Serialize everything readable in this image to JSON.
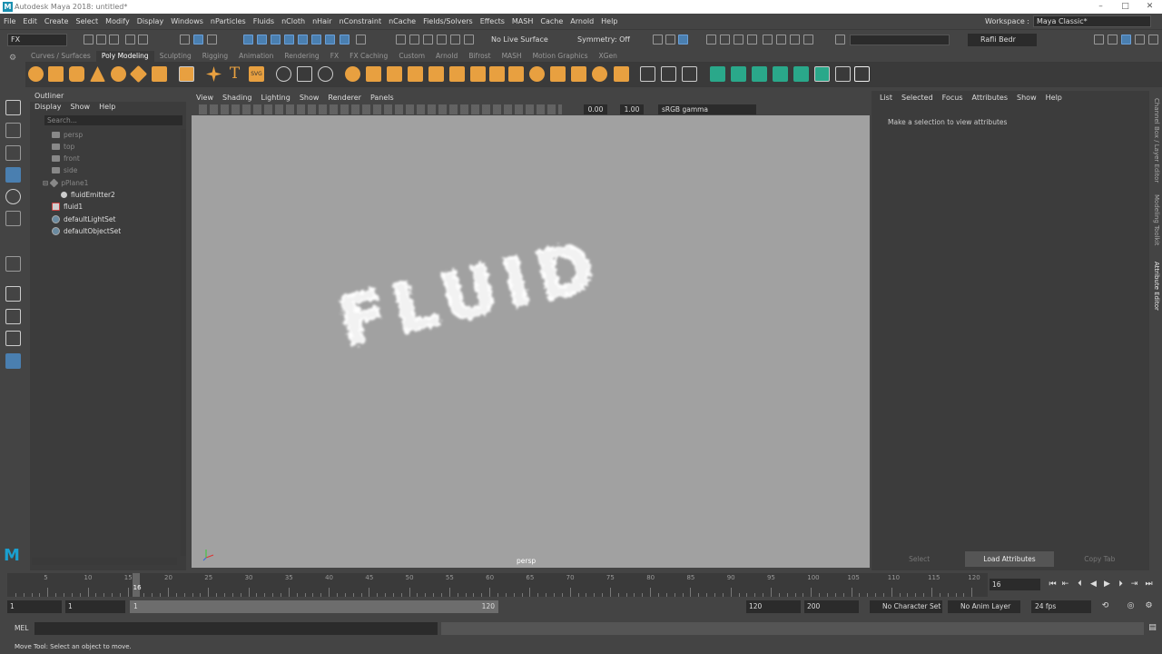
{
  "titlebar": {
    "title": "Autodesk Maya 2018: untitled*",
    "logo_letter": "M"
  },
  "menubar": {
    "items": [
      "File",
      "Edit",
      "Create",
      "Select",
      "Modify",
      "Display",
      "Windows",
      "nParticles",
      "Fluids",
      "nCloth",
      "nHair",
      "nConstraint",
      "nCache",
      "Fields/Solvers",
      "Effects",
      "MASH",
      "Cache",
      "Arnold",
      "Help"
    ],
    "workspace_label": "Workspace :",
    "workspace_value": "Maya Classic*"
  },
  "statusline": {
    "mode": "FX",
    "live_surface": "No Live Surface",
    "symmetry": "Symmetry: Off",
    "user": "Rafli Bedr"
  },
  "shelf": {
    "tabs": [
      "Curves / Surfaces",
      "Poly Modeling",
      "Sculpting",
      "Rigging",
      "Animation",
      "Rendering",
      "FX",
      "FX Caching",
      "Custom",
      "Arnold",
      "Bifrost",
      "MASH",
      "Motion Graphics",
      "XGen"
    ],
    "active_tab": "Poly Modeling",
    "text_icons": [
      "T",
      "SVG"
    ]
  },
  "outliner": {
    "title": "Outliner",
    "menu": [
      "Display",
      "Show",
      "Help"
    ],
    "search_placeholder": "Search...",
    "items": [
      {
        "label": "persp",
        "dim": true
      },
      {
        "label": "top",
        "dim": true
      },
      {
        "label": "front",
        "dim": true
      },
      {
        "label": "side",
        "dim": true
      },
      {
        "label": "pPlane1",
        "dim": true
      },
      {
        "label": "fluidEmitter2",
        "dim": false
      },
      {
        "label": "fluid1",
        "dim": false
      },
      {
        "label": "defaultLightSet",
        "dim": false
      },
      {
        "label": "defaultObjectSet",
        "dim": false
      }
    ]
  },
  "viewport": {
    "menu": [
      "View",
      "Shading",
      "Lighting",
      "Show",
      "Renderer",
      "Panels"
    ],
    "exposure": "0.00",
    "gamma": "1.00",
    "color_space": "sRGB gamma",
    "camera": "persp",
    "scene_text": "FLUID",
    "bg_color": "#a1a1a1"
  },
  "attribute_editor": {
    "menu": [
      "List",
      "Selected",
      "Focus",
      "Attributes",
      "Show",
      "Help"
    ],
    "message": "Make a selection to view attributes",
    "buttons": [
      "Select",
      "Load Attributes",
      "Copy Tab"
    ]
  },
  "side_tabs": [
    "Channel Box / Layer Editor",
    "Modeling Toolkit",
    "Attribute Editor"
  ],
  "timeslider": {
    "ticks": [
      5,
      10,
      15,
      20,
      25,
      30,
      35,
      40,
      45,
      50,
      55,
      60,
      65,
      70,
      75,
      80,
      85,
      90,
      95,
      100,
      105,
      110,
      115,
      120
    ],
    "current_frame": "16"
  },
  "rangeslider": {
    "start": "1",
    "range_start": "1",
    "range_inner_start": "1",
    "range_inner_end": "120",
    "range_end": "120",
    "end": "200",
    "character_set": "No Character Set",
    "anim_layer": "No Anim Layer",
    "fps": "24 fps"
  },
  "cmdline": {
    "label": "MEL"
  },
  "helpline": {
    "text": "Move Tool: Select an object to move."
  },
  "colors": {
    "accent_orange": "#e8a040",
    "accent_teal": "#2aa88a",
    "selection_blue": "#4a7fb0"
  }
}
